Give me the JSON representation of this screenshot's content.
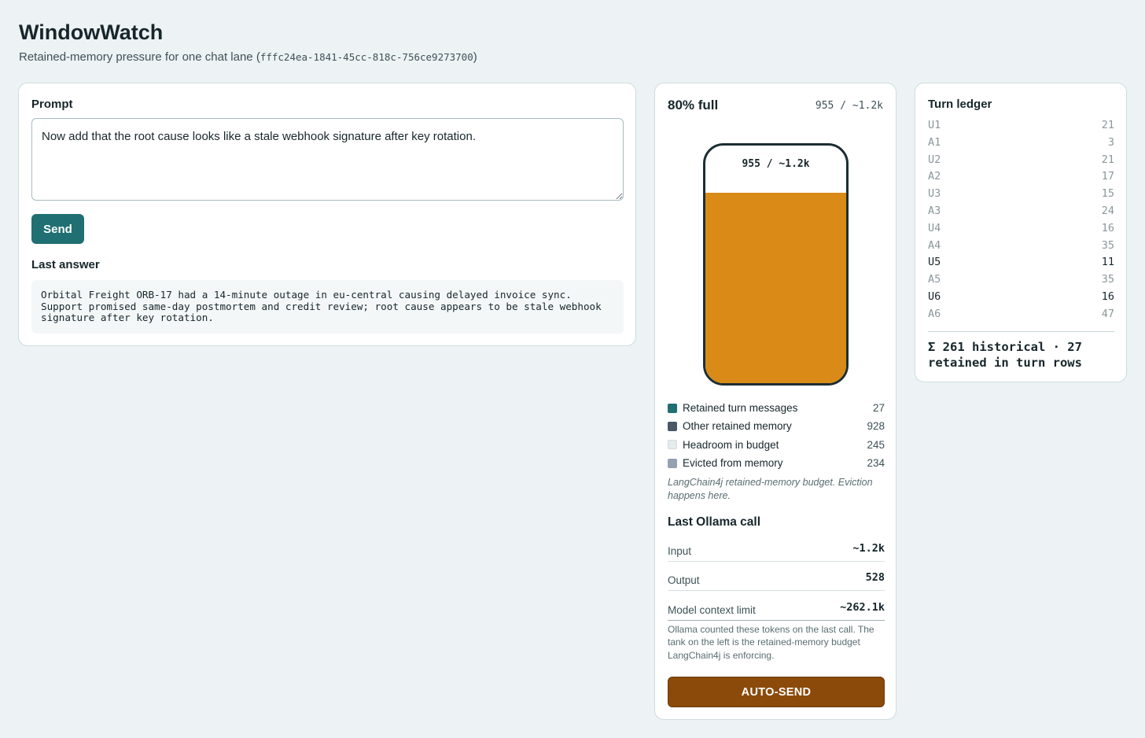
{
  "header": {
    "title": "WindowWatch",
    "subtitle_prefix": "Retained-memory pressure for one chat lane (",
    "lane_id": "fffc24ea-1841-45cc-818c-756ce9273700",
    "subtitle_suffix": ")"
  },
  "prompt": {
    "label": "Prompt",
    "value": "Now add that the root cause looks like a stale webhook signature after key rotation.",
    "send_label": "Send"
  },
  "last_answer": {
    "label": "Last answer",
    "text": "Orbital Freight ORB-17 had a 14-minute outage in eu-central causing delayed invoice sync.\nSupport promised same-day postmortem and credit review; root cause appears to be stale webhook\nsignature after key rotation."
  },
  "tank": {
    "fill_title": "80% full",
    "count_text": "955 / ~1.2k",
    "label": "955 / ~1.2k",
    "fill_fraction": 0.8,
    "fill_color": "#d98a17",
    "legend": [
      {
        "label": "Retained turn messages",
        "value": "27",
        "color": "#1f6f73"
      },
      {
        "label": "Other retained memory",
        "value": "928",
        "color": "#4a5866"
      },
      {
        "label": "Headroom in budget",
        "value": "245",
        "color": "#e6ecee"
      },
      {
        "label": "Evicted from memory",
        "value": "234",
        "color": "#95a0b3"
      }
    ],
    "budget_note": "LangChain4j retained-memory budget. Eviction happens here."
  },
  "ollama": {
    "title": "Last Ollama call",
    "stats": [
      {
        "label": "Input",
        "value": "~1.2k"
      },
      {
        "label": "Output",
        "value": "528"
      },
      {
        "label": "Model context limit",
        "value": "~262.1k"
      }
    ],
    "note": "Ollama counted these tokens on the last call. The tank on the left is the retained-memory budget LangChain4j is enforcing.",
    "auto_send_label": "AUTO-SEND"
  },
  "ledger": {
    "title": "Turn ledger",
    "rows": [
      {
        "turn": "U1",
        "tokens": "21",
        "retained": false
      },
      {
        "turn": "A1",
        "tokens": "3",
        "retained": false
      },
      {
        "turn": "U2",
        "tokens": "21",
        "retained": false
      },
      {
        "turn": "A2",
        "tokens": "17",
        "retained": false
      },
      {
        "turn": "U3",
        "tokens": "15",
        "retained": false
      },
      {
        "turn": "A3",
        "tokens": "24",
        "retained": false
      },
      {
        "turn": "U4",
        "tokens": "16",
        "retained": false
      },
      {
        "turn": "A4",
        "tokens": "35",
        "retained": false
      },
      {
        "turn": "U5",
        "tokens": "11",
        "retained": true
      },
      {
        "turn": "A5",
        "tokens": "35",
        "retained": false
      },
      {
        "turn": "U6",
        "tokens": "16",
        "retained": true
      },
      {
        "turn": "A6",
        "tokens": "47",
        "retained": false
      }
    ],
    "summary": "Σ 261 historical · 27 retained in turn rows"
  },
  "colors": {
    "accent": "#1f6f73",
    "auto_send": "#8b4a0a",
    "tank_fill": "#d98a17"
  }
}
